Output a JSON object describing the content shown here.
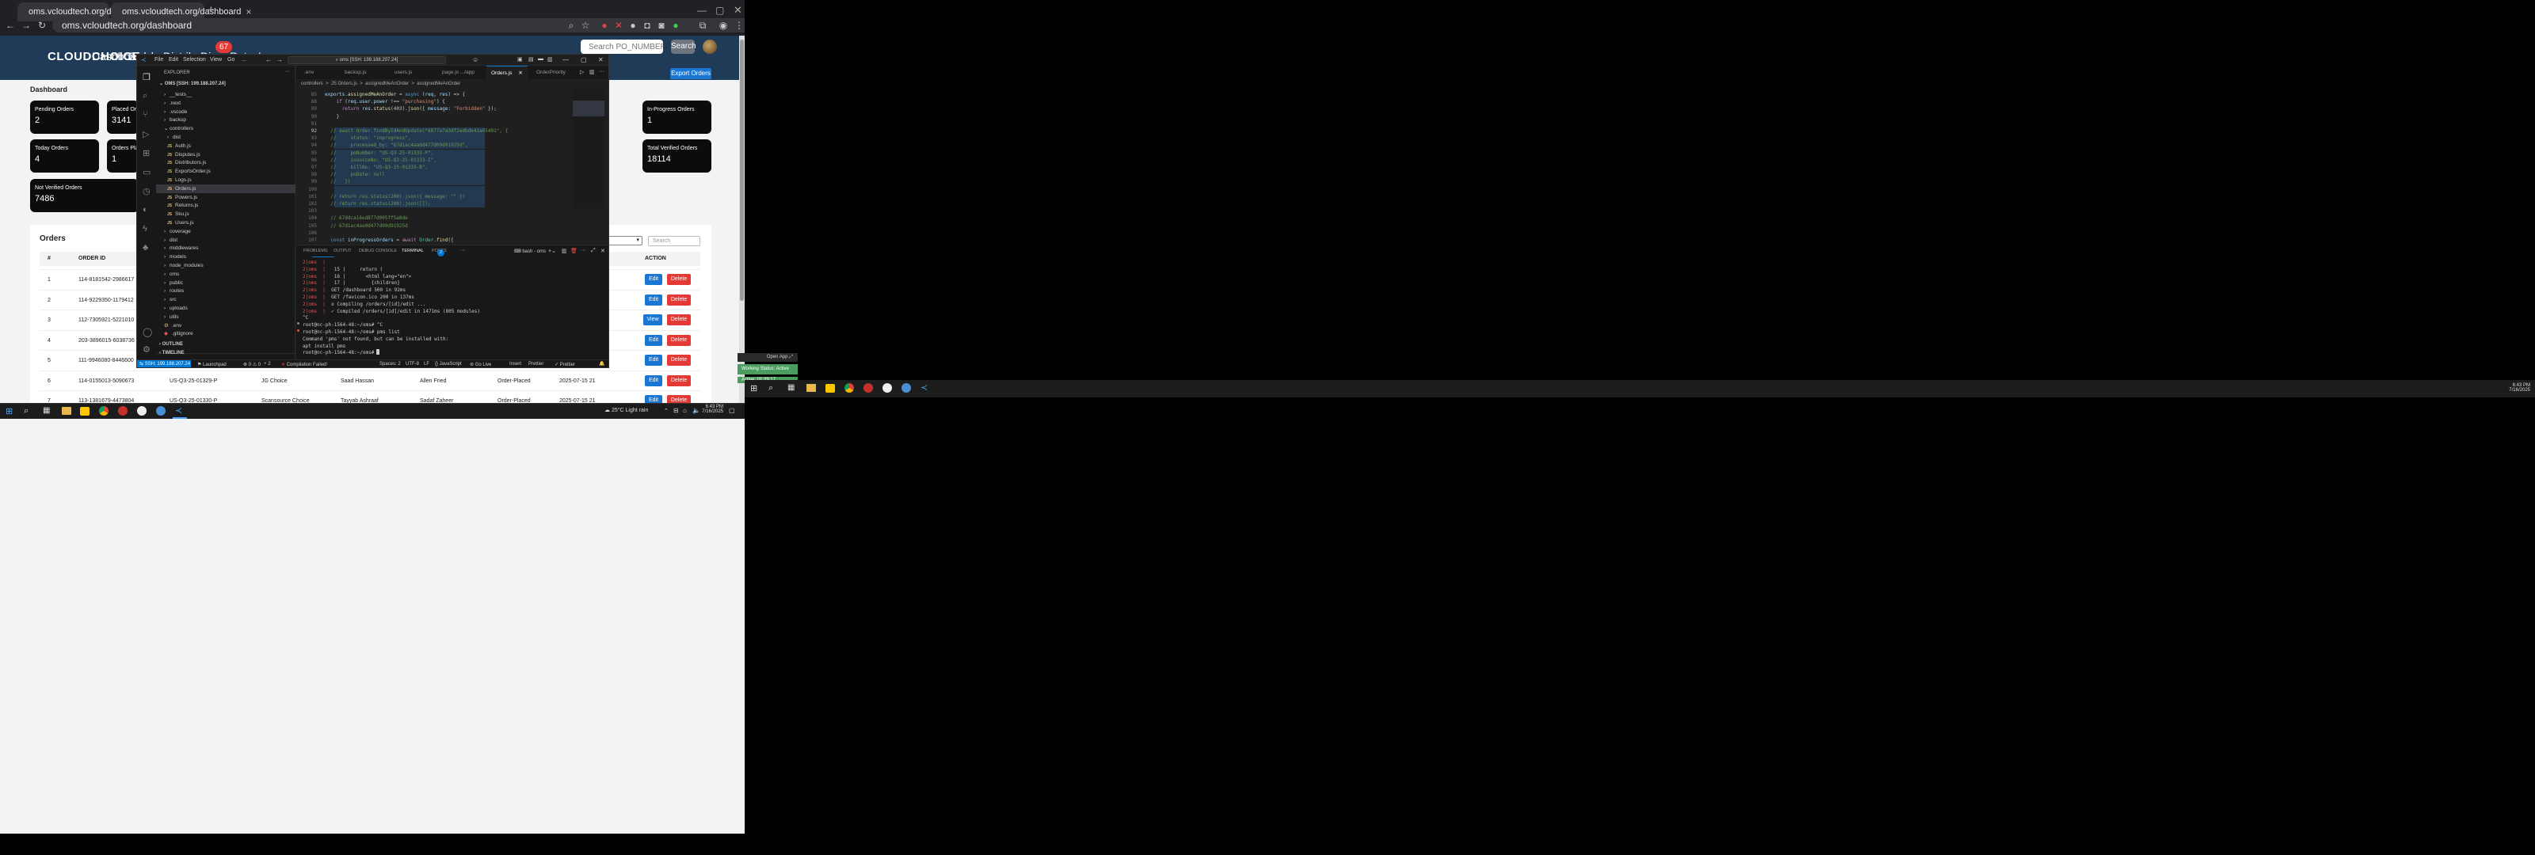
{
  "browser": {
    "tabs": [
      {
        "title": "oms.vcloudtech.org/dashboard"
      },
      {
        "title": "oms.vcloudtech.org/dashboard"
      }
    ],
    "url": "oms.vcloudtech.org/dashboard"
  },
  "app": {
    "logo": "CLOUDCHOICE",
    "nav": [
      "Dashboard",
      "Employees",
      "Distributors",
      "Dispu",
      "Returns",
      "Logs"
    ],
    "disputes_badge": "67",
    "search_placeholder": "Search PO_NUMBER...",
    "search_button": "Search",
    "page_title": "Dashboard",
    "export_button": "Export Orders",
    "cards": [
      {
        "title": "Pending Orders",
        "value": "2"
      },
      {
        "title": "Placed Or",
        "value": "3141"
      },
      {
        "title": "In-Progress Orders",
        "value": "1"
      },
      {
        "title": "Today Orders",
        "value": "4"
      },
      {
        "title": "Orders Plac",
        "value": "1"
      },
      {
        "title": "Total Verified Orders",
        "value": "18114"
      },
      {
        "title": "Not Verified Orders",
        "value": "7486"
      }
    ],
    "orders_title": "Orders",
    "table_search_placeholder": "Search",
    "columns": [
      "#",
      "ORDER ID",
      "ACTION"
    ],
    "rows": [
      {
        "n": "1",
        "order_id": "114-8181542-2986617",
        "po": "",
        "dist": "",
        "emp": "",
        "assigned": "",
        "status": "",
        "date": "",
        "action": "Edit"
      },
      {
        "n": "2",
        "order_id": "114-9229350-1179412",
        "po": "",
        "dist": "",
        "emp": "",
        "assigned": "",
        "status": "",
        "date": "",
        "action": "Edit"
      },
      {
        "n": "3",
        "order_id": "112-7305921-5221010",
        "po": "",
        "dist": "",
        "emp": "",
        "assigned": "",
        "status": "",
        "date": "",
        "action": "View"
      },
      {
        "n": "4",
        "order_id": "203-3896015-6038736",
        "po": "",
        "dist": "",
        "emp": "",
        "assigned": "",
        "status": "",
        "date": "",
        "action": "Edit"
      },
      {
        "n": "5",
        "order_id": "111-9946080-8446600",
        "po": "",
        "dist": "",
        "emp": "",
        "assigned": "",
        "status": "",
        "date": "",
        "action": "Edit"
      },
      {
        "n": "6",
        "order_id": "114-0155013-5090673",
        "po": "US-Q3-25-01329-P",
        "dist": "JG Choice",
        "emp": "Saad Hassan",
        "assigned": "Allen Fried",
        "status": "Order-Placed",
        "date": "2025-07-15 21",
        "action": "Edit"
      },
      {
        "n": "7",
        "order_id": "113-1381679-4473804",
        "po": "US-Q3-25-01330-P",
        "dist": "Scansource Choice",
        "emp": "Tayyab Ashraaf",
        "assigned": "Sadaf Zaheer",
        "status": "Order-Placed",
        "date": "2025-07-15 21",
        "action": "Edit"
      }
    ],
    "delete_label": "Delete"
  },
  "vscode": {
    "menus": [
      "File",
      "Edit",
      "Selection",
      "View",
      "Go",
      "..."
    ],
    "command_center": "oms [SSH: 199.188.207.24]",
    "explorer_title": "EXPLORER",
    "workspace": "OMS [SSH: 199.188.207.24]",
    "tree": [
      {
        "label": "__tests__",
        "depth": 1,
        "type": "folder"
      },
      {
        "label": ".next",
        "depth": 1,
        "type": "folder"
      },
      {
        "label": ".vscode",
        "depth": 1,
        "type": "folder"
      },
      {
        "label": "backup",
        "depth": 1,
        "type": "folder"
      },
      {
        "label": "controllers",
        "depth": 1,
        "type": "folder-open"
      },
      {
        "label": "dist",
        "depth": 2,
        "type": "folder"
      },
      {
        "label": "Auth.js",
        "depth": 2,
        "type": "js"
      },
      {
        "label": "Disputes.js",
        "depth": 2,
        "type": "js"
      },
      {
        "label": "Distributors.js",
        "depth": 2,
        "type": "js"
      },
      {
        "label": "ExportsOrder.js",
        "depth": 2,
        "type": "js"
      },
      {
        "label": "Logs.js",
        "depth": 2,
        "type": "js"
      },
      {
        "label": "Orders.js",
        "depth": 2,
        "type": "js"
      },
      {
        "label": "Powers.js",
        "depth": 2,
        "type": "js"
      },
      {
        "label": "Returns.js",
        "depth": 2,
        "type": "js"
      },
      {
        "label": "Sku.js",
        "depth": 2,
        "type": "js"
      },
      {
        "label": "Users.js",
        "depth": 2,
        "type": "js"
      },
      {
        "label": "coverage",
        "depth": 1,
        "type": "folder"
      },
      {
        "label": "dist",
        "depth": 1,
        "type": "folder"
      },
      {
        "label": "middlewares",
        "depth": 1,
        "type": "folder"
      },
      {
        "label": "models",
        "depth": 1,
        "type": "folder"
      },
      {
        "label": "node_modules",
        "depth": 1,
        "type": "folder"
      },
      {
        "label": "oms",
        "depth": 1,
        "type": "folder"
      },
      {
        "label": "public",
        "depth": 1,
        "type": "folder"
      },
      {
        "label": "routes",
        "depth": 1,
        "type": "folder"
      },
      {
        "label": "src",
        "depth": 1,
        "type": "folder"
      },
      {
        "label": "uploads",
        "depth": 1,
        "type": "folder"
      },
      {
        "label": "utils",
        "depth": 1,
        "type": "folder"
      },
      {
        "label": ".env",
        "depth": 1,
        "type": "env"
      },
      {
        "label": ".gitignore",
        "depth": 1,
        "type": "git"
      }
    ],
    "outline": "OUTLINE",
    "timeline": "TIMELINE",
    "tabs": [
      ".env",
      "backup.js",
      "users.js",
      "page.js .../app",
      "Orders.js",
      "OrderPriority"
    ],
    "breadcrumb": "controllers  >  JS Orders.js  >  assignedMeAnOrder  >  assignedMeAnOrder",
    "code_first_line": 85,
    "code_last_line": 107,
    "panel_tabs": [
      "PROBLEMS",
      "OUTPUT",
      "DEBUG CONSOLE",
      "TERMINAL",
      "PORTS"
    ],
    "ports_count": "2",
    "terminal_label": "bash - oms",
    "terminal": [
      "2|oms  |",
      "2|oms  |   15 |     return (",
      "2|oms  |   16 |       <html lang=\"en\">",
      "2|oms  |   17 |         {children}",
      "2|oms  |  GET /dashboard 500 in 92ms",
      "2|oms  |  GET /favicon.ico 200 in 137ms",
      "2|oms  |  o Compiling /orders/[id]/edit ...",
      "2|oms  |  ✓ Compiled /orders/[id]/edit in 1471ms (805 modules)",
      "^C",
      "root@nc-ph-1564-48:~/oms# ^C",
      "root@nc-ph-1564-48:~/oms# pms list",
      "Command 'pms' not found, but can be installed with:",
      "apt install pms",
      "root@nc-ph-1564-48:~/oms# "
    ],
    "status": {
      "remote": "SSH: 199.188.207.24",
      "launchpad": "Launchpad",
      "errors": "⊗ 0 ⚠ 0",
      "ports": "2",
      "compilation": "Compilation Failed!",
      "spaces": "Spaces: 2",
      "encoding": "UTF-8",
      "eol": "LF",
      "lang": "{} JavaScript",
      "golive": "Go Live",
      "insert": "Insert",
      "prettier": "Prettier",
      "prettier2": "✓ Prettier"
    }
  },
  "taskbar": {
    "weather": "25°C  Light rain",
    "time": "6:43 PM",
    "date": "7/16/2025"
  },
  "second_monitor": {
    "open_app": "Open App",
    "working_status": "Working Status: Active",
    "active": "Active: 01:29:17",
    "time": "6:43 PM",
    "date": "7/16/2025"
  }
}
